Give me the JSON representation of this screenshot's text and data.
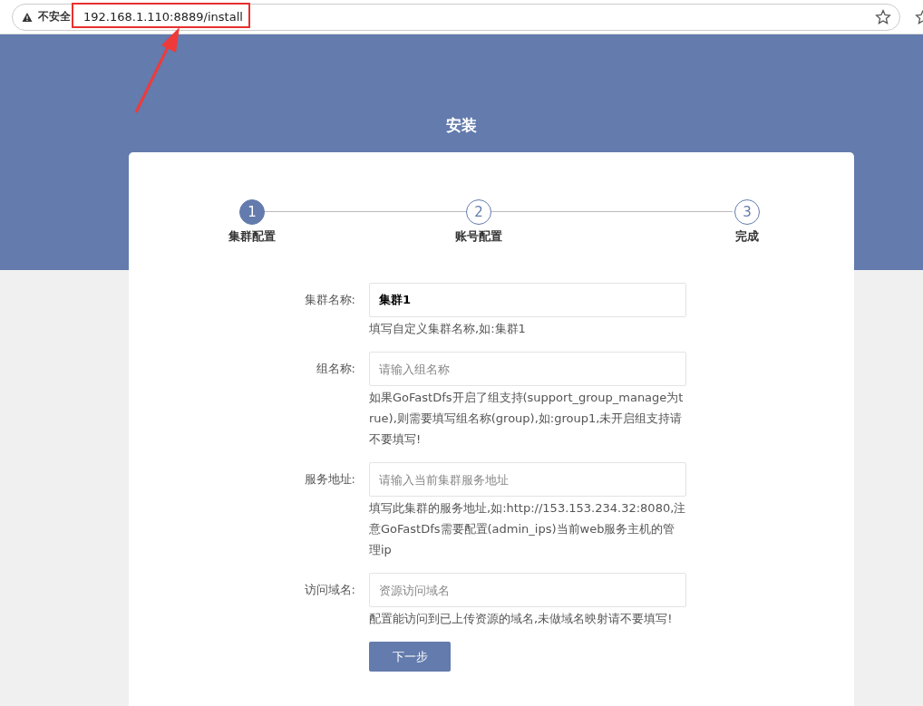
{
  "browser": {
    "security_label": "不安全",
    "url": "192.168.1.110:8889/install"
  },
  "page_title": "安装",
  "steps": [
    {
      "number": "1",
      "label": "集群配置",
      "selected": true
    },
    {
      "number": "2",
      "label": "账号配置",
      "selected": false
    },
    {
      "number": "3",
      "label": "完成",
      "selected": false
    }
  ],
  "fields": [
    {
      "label": "集群名称:",
      "value": "集群1",
      "help": "填写自定义集群名称,如:集群1"
    },
    {
      "label": "组名称:",
      "placeholder": "请输入组名称",
      "help": "如果GoFastDfs开启了组支持(support_group_manage为true),则需要填写组名称(group),如:group1,未开启组支持请不要填写!"
    },
    {
      "label": "服务地址:",
      "placeholder": "请输入当前集群服务地址",
      "help": "填写此集群的服务地址,如:http://153.153.234.32:8080,注意GoFastDfs需要配置(admin_ips)当前web服务主机的管理ip"
    },
    {
      "label": "访问域名:",
      "placeholder": "资源访问域名",
      "help": "配置能访问到已上传资源的域名,未做域名映射请不要填写!"
    }
  ],
  "next_button": "下一步"
}
